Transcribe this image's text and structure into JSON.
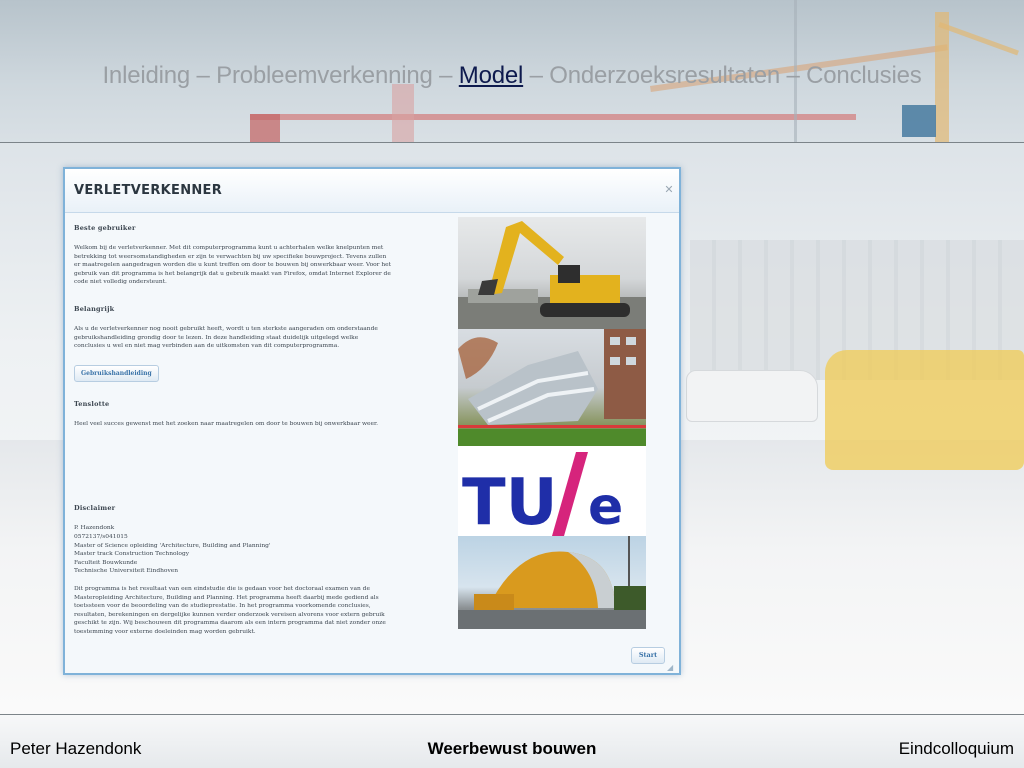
{
  "slide": {
    "nav": {
      "items": [
        {
          "label": "Inleiding",
          "current": false
        },
        {
          "label": "Probleemverkenning",
          "current": false
        },
        {
          "label": "Model",
          "current": true
        },
        {
          "label": "Onderzoeksresultaten",
          "current": false
        },
        {
          "label": "Conclusies",
          "current": false
        }
      ],
      "separator": " – "
    },
    "footer": {
      "left": "Peter Hazendonk",
      "center": "Weerbewust bouwen",
      "right": "Eindcolloquium"
    }
  },
  "dialog": {
    "title": "VERLETVERKENNER",
    "close_icon": "close-icon",
    "sections": {
      "beste_gebruiker": {
        "heading": "Beste gebruiker",
        "lines": [
          "Welkom bij de verletverkenner. Met dit computerprogramma kunt u achterhalen welke knelpunten met",
          "betrekking tot weersomstandigheden er zijn te verwachten bij uw specifieke bouwproject. Tevens zullen",
          "er maatregelen aangedragen worden die u kunt treffen om door te bouwen bij onwerkbaar weer. Voor het",
          "gebruik van dit programma is het belangrijk dat u gebruik maakt van Firefox, omdat Internet Explorer de",
          "code niet volledig ondersteunt."
        ]
      },
      "belangrijk": {
        "heading": "Belangrijk",
        "lines": [
          "Als u de verletverkenner nog nooit gebruikt heeft, wordt u ten sterkste aangeraden om onderstaande",
          "gebruikshandleiding grondig door te lezen. In deze handleiding staat duidelijk uitgelegd welke",
          "conclusies u wel en niet mag verbinden aan de uitkomsten van dit computerprogramma."
        ],
        "button": "Gebruikshandleiding"
      },
      "tenslotte": {
        "heading": "Tenslotte",
        "lines": [
          "Heel veel succes gewenst met het zoeken naar maatregelen om door te bouwen bij onwerkbaar weer."
        ]
      },
      "disclaimer": {
        "heading": "Disclaimer",
        "author_lines": [
          "P. Hazendonk",
          "0572137/s041015",
          "Master of Science opleiding 'Architecture, Building and Planning'",
          "Master track Construction Technology",
          "Faculteit Bouwkunde",
          "Technische Universiteit Eindhoven"
        ],
        "lines": [
          "Dit programma is het resultaat van een eindstudie die is gedaan voor het doctoraal examen van de",
          "Masteropleiding Architecture, Building and Planning. Het programma heeft daarbij mede gediend als",
          "toetssteen voor de beoordeling van de studieprestatie. In het programma voorkomende conclusies,",
          "resultaten, berekeningen en dergelijke kunnen verder onderzoek vereisen alvorens voor extern gebruik",
          "geschikt te zijn. Wij beschouwen dit programma daarom als een intern programma dat niet zonder onze",
          "toestemming voor externe doeleinden mag worden gebruikt."
        ]
      }
    },
    "photos": {
      "excavator": "excavator-photo",
      "collapsed_building": "collapsed-building-photo",
      "logo_text_left": "TU",
      "logo_text_right": "e",
      "logo_slash_color": "#d6247c",
      "logo_text_color": "#1f2ea8",
      "tent": "construction-tent-photo"
    },
    "start_button": "Start"
  },
  "colors": {
    "nav_inactive": "#9a9fa4",
    "nav_active": "#0e1a4e",
    "dialog_border": "#7fb2d9",
    "button_text": "#3a73a8"
  }
}
